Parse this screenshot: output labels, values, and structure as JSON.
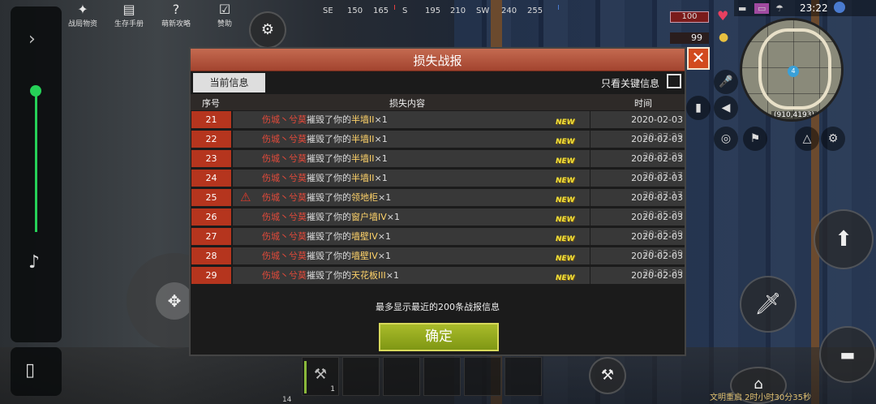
{
  "top_menu": [
    {
      "label": "战局物资",
      "icon": "supplies-icon"
    },
    {
      "label": "生存手册",
      "icon": "manual-icon"
    },
    {
      "label": "萌新攻略",
      "icon": "guide-icon"
    },
    {
      "label": "赞助",
      "icon": "sponsor-icon"
    }
  ],
  "compass": [
    "SE",
    "150",
    "165",
    "S",
    "195",
    "210",
    "SW",
    "240",
    "255"
  ],
  "status": {
    "time": "23:22",
    "health": "100",
    "food": "99"
  },
  "minimap": {
    "coord": "(910,4193)",
    "player_marker": "4"
  },
  "modal": {
    "title": "损失战报",
    "tab_current": "当前信息",
    "filter_label": "只看关键信息",
    "columns": {
      "index": "序号",
      "content": "损失内容",
      "time": "时间"
    },
    "new_badge": "NEW",
    "rows": [
      {
        "index": "21",
        "who": "伤城丶兮莫",
        "verb": "摧毁了你的",
        "item": "半墙II",
        "qty": "×1",
        "time": "2020-02-03 20:27:29",
        "warn": false
      },
      {
        "index": "22",
        "who": "伤城丶兮莫",
        "verb": "摧毁了你的",
        "item": "半墙II",
        "qty": "×1",
        "time": "2020-02-03 20:27:29",
        "warn": false
      },
      {
        "index": "23",
        "who": "伤城丶兮莫",
        "verb": "摧毁了你的",
        "item": "半墙II",
        "qty": "×1",
        "time": "2020-02-03 20:27:17",
        "warn": false
      },
      {
        "index": "24",
        "who": "伤城丶兮莫",
        "verb": "摧毁了你的",
        "item": "半墙II",
        "qty": "×1",
        "time": "2020-02-03 20:27:17",
        "warn": false
      },
      {
        "index": "25",
        "who": "伤城丶兮莫",
        "verb": "摧毁了你的",
        "item": "领地柜",
        "qty": "×1",
        "time": "2020-02-03 20:25:20",
        "warn": true
      },
      {
        "index": "26",
        "who": "伤城丶兮莫",
        "verb": "摧毁了你的",
        "item": "窗户墙IV",
        "qty": "×1",
        "time": "2020-02-03 20:25:20",
        "warn": false
      },
      {
        "index": "27",
        "who": "伤城丶兮莫",
        "verb": "摧毁了你的",
        "item": "墙壁IV",
        "qty": "×1",
        "time": "2020-02-03 20:25:20",
        "warn": false
      },
      {
        "index": "28",
        "who": "伤城丶兮莫",
        "verb": "摧毁了你的",
        "item": "墙壁IV",
        "qty": "×1",
        "time": "2020-02-03 20:25:20",
        "warn": false
      },
      {
        "index": "29",
        "who": "伤城丶兮莫",
        "verb": "摧毁了你的",
        "item": "天花板III",
        "qty": "×1",
        "time": "2020-02-03 20:25:20",
        "warn": false
      }
    ],
    "footer_note": "最多显示最近的200条战报信息",
    "confirm_label": "确定"
  },
  "hotbar": {
    "slot1_count": "1",
    "slot_number": "14"
  },
  "bottom_note": "文明重启 2时小时30分35秒"
}
